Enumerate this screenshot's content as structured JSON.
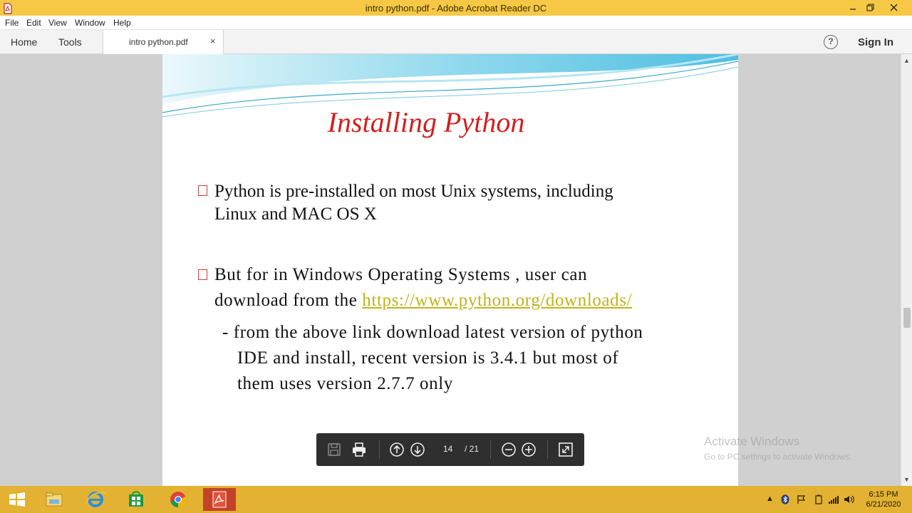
{
  "window": {
    "title": "intro python.pdf - Adobe Acrobat Reader DC"
  },
  "menu": [
    "File",
    "Edit",
    "View",
    "Window",
    "Help"
  ],
  "nav": {
    "home": "Home",
    "tools": "Tools",
    "doc_tab": "intro python.pdf",
    "close": "×",
    "help": "?",
    "sign_in": "Sign In"
  },
  "slide": {
    "title": "Installing Python",
    "bullet1_line1": "Python is pre-installed on most Unix systems, including",
    "bullet1_line2": "Linux and MAC OS X",
    "bullet2_line1": "But for in Windows Operating Systems , user can",
    "bullet2_line2_prefix": "download from the ",
    "bullet2_link": "https://www.python.org/downloads/",
    "sub_line1": "- from the above link download latest version of python",
    "sub_line2": "IDE and install, recent version is 3.4.1 but most of",
    "sub_line3": "them uses version 2.7.7 only"
  },
  "toolbar": {
    "current_page": "14",
    "total_pages": "/ 21"
  },
  "watermark": {
    "line1": "Activate Windows",
    "line2": "Go to PC settings to activate Windows."
  },
  "taskbar": {
    "time": "6:15 PM",
    "date": "6/21/2020"
  },
  "colors": {
    "title_bar": "#f6c846",
    "slide_title": "#d21f1f",
    "link": "#c2b21a",
    "taskbar": "#e3b233"
  }
}
